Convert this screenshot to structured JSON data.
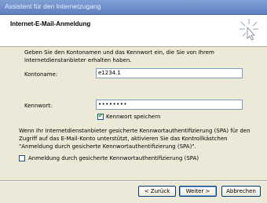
{
  "window": {
    "title": "Assistent für den Internetzugang"
  },
  "header": {
    "heading": "Internet-E-Mail-Anmeldung"
  },
  "intro": {
    "line1": "Geben Sie den Kontonamen und das Kennwort ein, die Sie von Ihrem",
    "line2": "Internetdienstanbieter erhalten haben."
  },
  "account": {
    "label": "Kontoname:",
    "value": "e1234.1"
  },
  "password": {
    "label": "Kennwort:",
    "value": "••••••••"
  },
  "remember": {
    "label": "Kennwort speichern",
    "checked": true
  },
  "spa": {
    "line1": "Wenn Ihr Internetdienstanbieter gesicherte Kennwortauthentifizierung (SPA) für den",
    "line2": "Zugriff auf das E-Mail-Konto unterstützt, aktivieren Sie das Kontrollkästchen",
    "line3": "\"Anmeldung durch gesicherte Kennwortauthentifizierung (SPA)\".",
    "checkbox_label": "Anmeldung durch gesicherte Kennwortauthentifizierung (SPA)",
    "checked": false
  },
  "buttons": {
    "back": "< Zurück",
    "next": "Weiter >",
    "cancel": "Abbrechen"
  },
  "icons": {
    "wizard": "wizard-sparkle-icon",
    "check": "checkmark-icon"
  }
}
